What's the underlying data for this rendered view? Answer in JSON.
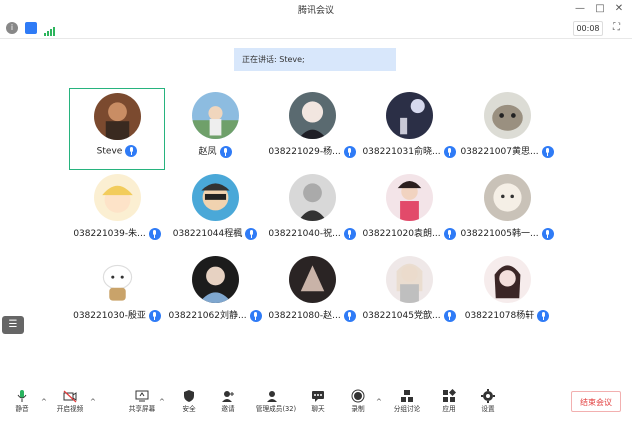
{
  "window": {
    "title": "腾讯会议",
    "minimize": "—",
    "maximize": "□",
    "close": "✕"
  },
  "topbar": {
    "timer": "00:08"
  },
  "speaking_banner": "正在讲话: Steve;",
  "participants": [
    {
      "name": "Steve",
      "active": true
    },
    {
      "name": "赵凤"
    },
    {
      "name": "038221029-杨..."
    },
    {
      "name": "038221031俞晓..."
    },
    {
      "name": "038221007黄思..."
    },
    {
      "name": "038221039-朱..."
    },
    {
      "name": "038221044程楓"
    },
    {
      "name": "038221040-祝..."
    },
    {
      "name": "038221020袁朗..."
    },
    {
      "name": "038221005韩一..."
    },
    {
      "name": "038221030-殷亚"
    },
    {
      "name": "038221062刘静..."
    },
    {
      "name": "038221080-赵..."
    },
    {
      "name": "038221045党歆..."
    },
    {
      "name": "038221078杨轩"
    }
  ],
  "toolbar": {
    "mute": "静音",
    "video": "开启视频",
    "share": "共享屏幕",
    "security": "安全",
    "invite": "邀请",
    "members": "管理成员(32)",
    "chat": "聊天",
    "record": "录制",
    "breakout": "分组讨论",
    "apps": "应用",
    "settings": "设置",
    "end": "结束会议"
  }
}
